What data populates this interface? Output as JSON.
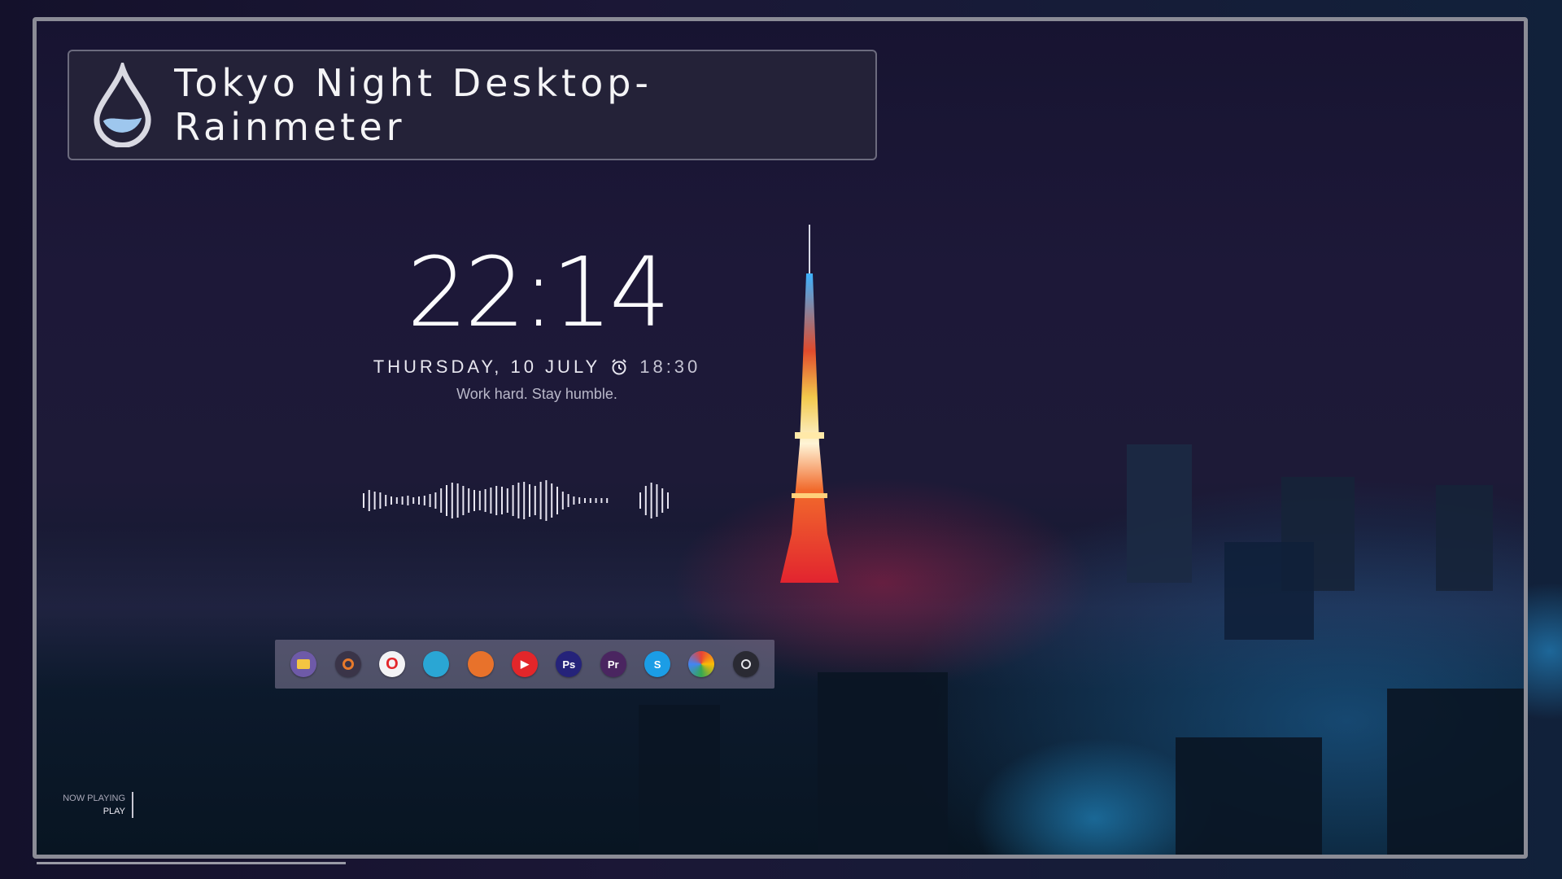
{
  "title": "Tokyo Night Desktop-Rainmeter",
  "clock": {
    "time": "22:14",
    "date": "THURSDAY, 10 JULY",
    "alarm_time": "18:30",
    "quote": "Work hard. Stay humble."
  },
  "dock": {
    "apps": [
      {
        "name": "file-explorer",
        "glyph": "",
        "color": "#6e5aa8"
      },
      {
        "name": "settings",
        "glyph": "",
        "color": "#3a3448"
      },
      {
        "name": "opera",
        "glyph": "O",
        "color": "#f3f3f5"
      },
      {
        "name": "maps",
        "glyph": "",
        "color": "#2aa6d4"
      },
      {
        "name": "firefox",
        "glyph": "",
        "color": "#e8722b"
      },
      {
        "name": "youtube",
        "glyph": "▶",
        "color": "#e3262a"
      },
      {
        "name": "photoshop",
        "glyph": "Ps",
        "color": "#25237a"
      },
      {
        "name": "premiere",
        "glyph": "Pr",
        "color": "#4a2560"
      },
      {
        "name": "skype",
        "glyph": "S",
        "color": "#1b9de6"
      },
      {
        "name": "photos",
        "glyph": "",
        "color": "#f2f2f4"
      },
      {
        "name": "steam",
        "glyph": "",
        "color": "#2a2a33"
      }
    ]
  },
  "now_playing": {
    "label": "NOW PLAYING",
    "value": "PLAY"
  }
}
